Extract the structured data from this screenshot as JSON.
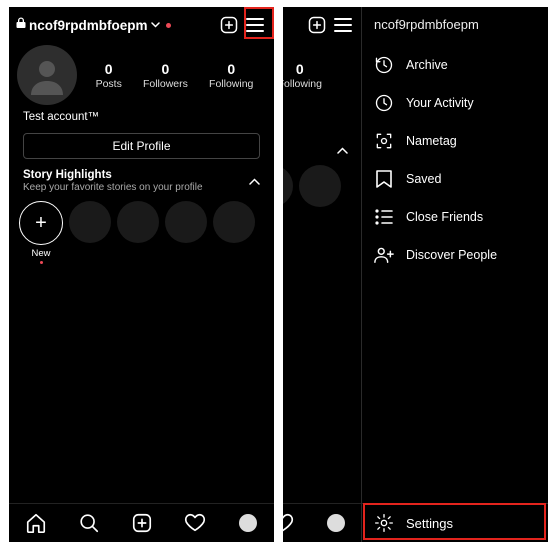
{
  "header": {
    "username": "ncof9rpdmbfoepm"
  },
  "stats": {
    "posts": {
      "n": "0",
      "l": "Posts"
    },
    "followers": {
      "n": "0",
      "l": "Followers"
    },
    "following": {
      "n": "0",
      "l": "Following"
    }
  },
  "bio": "Test account™",
  "edit_profile": "Edit Profile",
  "highlights": {
    "title": "Story Highlights",
    "sub": "Keep your favorite stories on your profile",
    "new": "New",
    "plus": "+"
  },
  "drawer": {
    "title": "ncof9rpdmbfoepm",
    "items": [
      {
        "label": "Archive"
      },
      {
        "label": "Your Activity"
      },
      {
        "label": "Nametag"
      },
      {
        "label": "Saved"
      },
      {
        "label": "Close Friends"
      },
      {
        "label": "Discover People"
      }
    ],
    "settings": "Settings"
  }
}
